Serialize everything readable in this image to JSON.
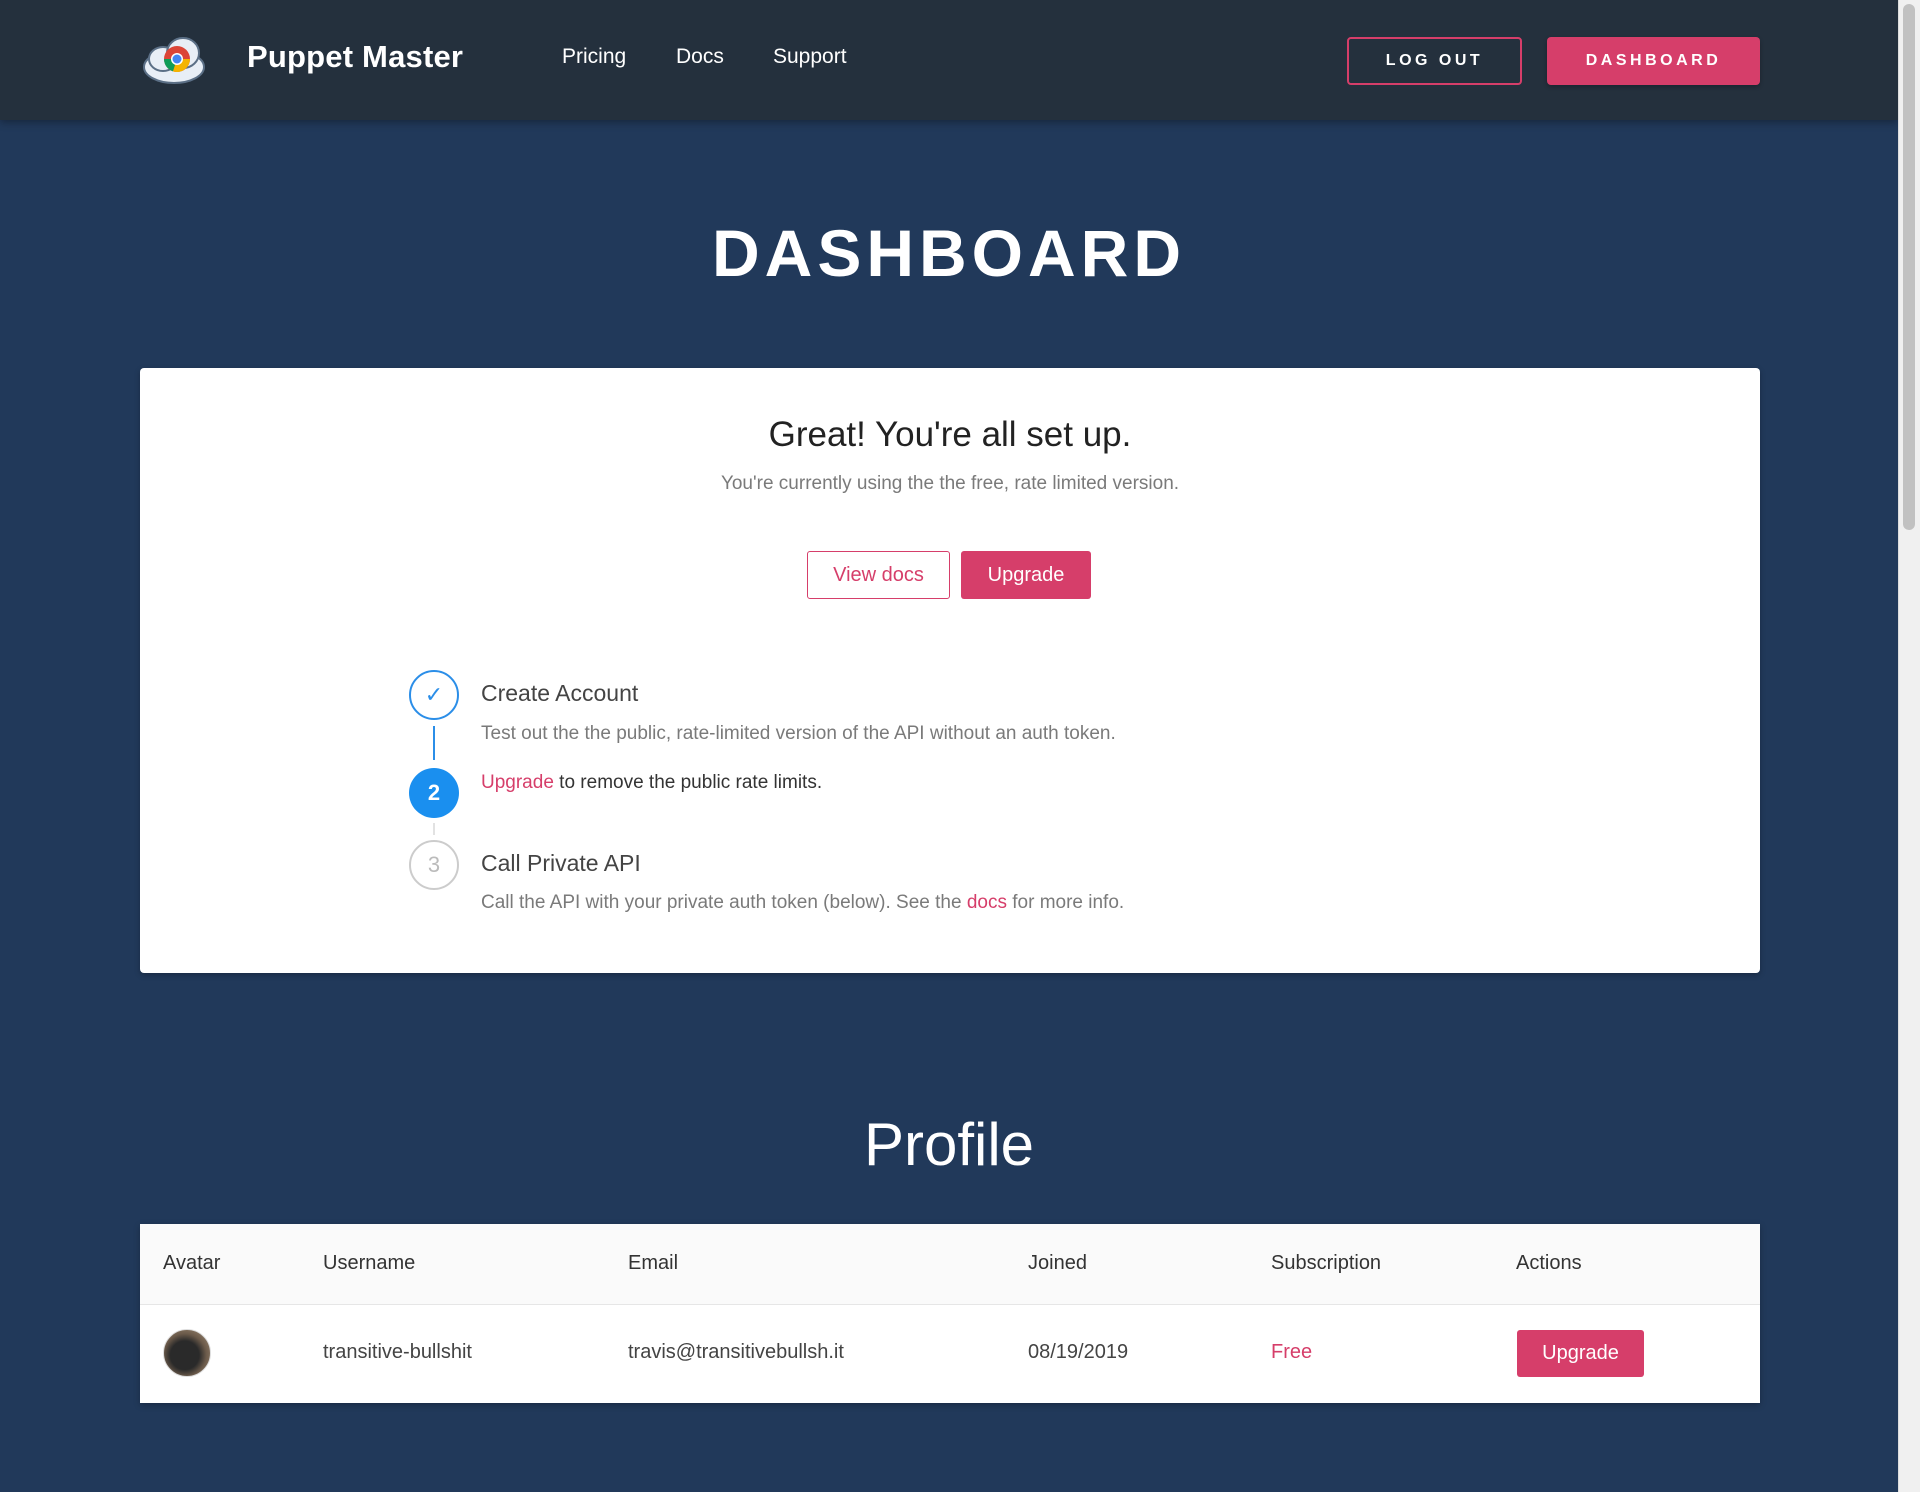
{
  "header": {
    "brand": "Puppet Master",
    "nav": [
      "Pricing",
      "Docs",
      "Support"
    ],
    "logout_label": "LOG OUT",
    "dashboard_label": "DASHBOARD"
  },
  "page_title": "DASHBOARD",
  "setup": {
    "heading": "Great! You're all set up.",
    "subtitle": "You're currently using the the free, rate limited version.",
    "view_docs_label": "View docs",
    "upgrade_label": "Upgrade",
    "steps": [
      {
        "marker": "✓",
        "title": "Create Account",
        "description": "Test out the the public, rate-limited version of the API without an auth token.",
        "status": "done"
      },
      {
        "marker": "2",
        "link_text": "Upgrade",
        "text": " to remove the public rate limits.",
        "status": "active"
      },
      {
        "marker": "3",
        "title": "Call Private API",
        "description_before": "Call the API with your private auth token (below). See the ",
        "description_link": "docs",
        "description_after": " for more info.",
        "status": "todo"
      }
    ]
  },
  "profile": {
    "title": "Profile",
    "columns": [
      "Avatar",
      "Username",
      "Email",
      "Joined",
      "Subscription",
      "Actions"
    ],
    "row": {
      "username": "transitive-bullshit",
      "email": "travis@transitivebullsh.it",
      "joined": "08/19/2019",
      "subscription": "Free",
      "action_label": "Upgrade"
    }
  },
  "colors": {
    "accent": "#d63e6a",
    "header_bg": "#24303d",
    "page_bg": "#21395a",
    "step_blue": "#1a8fef"
  }
}
